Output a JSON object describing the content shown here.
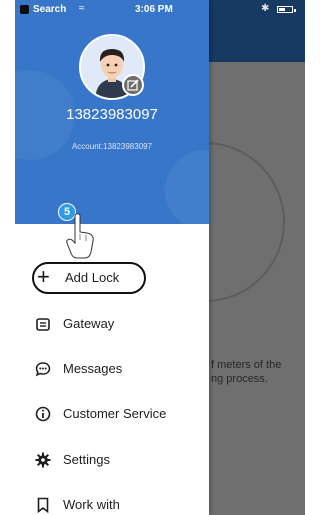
{
  "status_bar": {
    "back_label": "Search",
    "time": "3:06 PM"
  },
  "background_app": {
    "partial_text": "f meters of the\nng process."
  },
  "drawer": {
    "phone": "13823983097",
    "account": "Account:13823983097",
    "step_badge": "5",
    "menu": [
      {
        "label": "Add Lock",
        "icon": "plus-icon"
      },
      {
        "label": "Gateway",
        "icon": "gateway-icon"
      },
      {
        "label": "Messages",
        "icon": "chat-bubble-icon"
      },
      {
        "label": "Customer Service",
        "icon": "info-icon"
      },
      {
        "label": "Settings",
        "icon": "gear-icon"
      },
      {
        "label": "Work with",
        "icon": "bookmark-icon"
      }
    ]
  },
  "colors": {
    "drawer_header": "#3776c8",
    "step_badge": "#2b9ae8",
    "overlay": "#6f6f6f"
  }
}
